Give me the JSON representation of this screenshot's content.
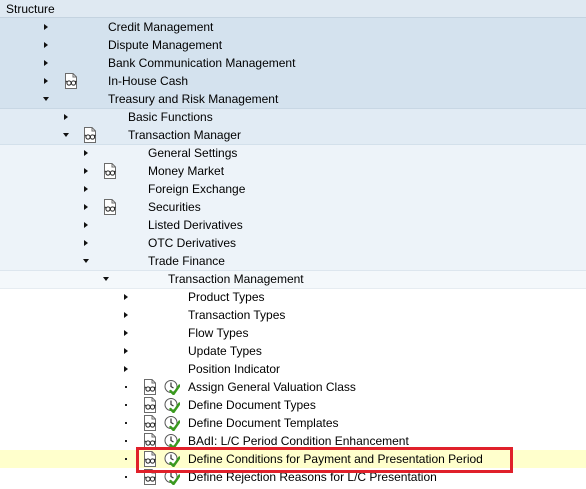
{
  "header": {
    "title": "Structure"
  },
  "tree": [
    {
      "label": "Credit Management",
      "expander": "right",
      "icons": []
    },
    {
      "label": "Dispute Management",
      "expander": "right",
      "icons": []
    },
    {
      "label": "Bank Communication Management",
      "expander": "right",
      "icons": []
    },
    {
      "label": "In-House Cash",
      "expander": "right",
      "icons": [
        "glasses-doc-icon"
      ]
    },
    {
      "label": "Treasury and Risk Management",
      "expander": "down",
      "icons": []
    },
    {
      "label": "Basic Functions",
      "expander": "right",
      "icons": []
    },
    {
      "label": "Transaction Manager",
      "expander": "down",
      "icons": [
        "glasses-doc-icon"
      ]
    },
    {
      "label": "General Settings",
      "expander": "right",
      "icons": []
    },
    {
      "label": "Money Market",
      "expander": "right",
      "icons": [
        "glasses-doc-icon"
      ]
    },
    {
      "label": "Foreign Exchange",
      "expander": "right",
      "icons": []
    },
    {
      "label": "Securities",
      "expander": "right",
      "icons": [
        "glasses-doc-icon"
      ]
    },
    {
      "label": "Listed Derivatives",
      "expander": "right",
      "icons": []
    },
    {
      "label": "OTC Derivatives",
      "expander": "right",
      "icons": []
    },
    {
      "label": "Trade Finance",
      "expander": "down",
      "icons": []
    },
    {
      "label": "Transaction Management",
      "expander": "down",
      "icons": []
    },
    {
      "label": "Product Types",
      "expander": "right",
      "icons": []
    },
    {
      "label": "Transaction Types",
      "expander": "right",
      "icons": []
    },
    {
      "label": "Flow Types",
      "expander": "right",
      "icons": []
    },
    {
      "label": "Update Types",
      "expander": "right",
      "icons": []
    },
    {
      "label": "Position Indicator",
      "expander": "right",
      "icons": []
    },
    {
      "label": "Assign General Valuation Class",
      "expander": "bullet",
      "icons": [
        "glasses-doc-icon",
        "execute-clock-icon"
      ]
    },
    {
      "label": "Define Document Types",
      "expander": "bullet",
      "icons": [
        "glasses-doc-icon",
        "execute-clock-icon"
      ]
    },
    {
      "label": "Define Document Templates",
      "expander": "bullet",
      "icons": [
        "glasses-doc-icon",
        "execute-clock-icon"
      ]
    },
    {
      "label": "BAdI: L/C Period Condition Enhancement",
      "expander": "bullet",
      "icons": [
        "glasses-doc-icon",
        "execute-clock-icon"
      ]
    },
    {
      "label": "Define Conditions for Payment and Presentation Period",
      "expander": "bullet",
      "icons": [
        "glasses-doc-icon",
        "execute-clock-icon"
      ],
      "selected": true
    },
    {
      "label": "Define Rejection Reasons for L/C Presentation",
      "expander": "bullet",
      "icons": [
        "glasses-doc-icon",
        "execute-clock-icon"
      ]
    }
  ],
  "colors": {
    "highlight_border": "#e0202a",
    "selected_row": "#ffffcc",
    "check_green": "#3a9a1e"
  }
}
